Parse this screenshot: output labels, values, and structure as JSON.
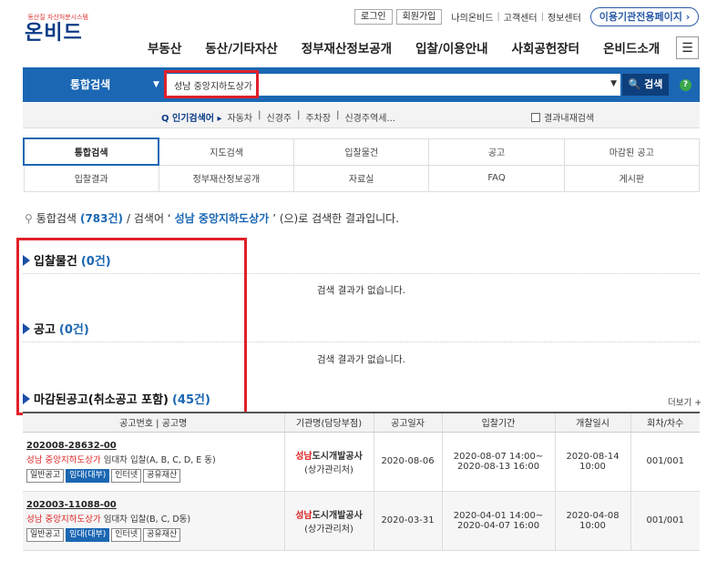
{
  "util": {
    "login": "로그인",
    "signup": "회원가입",
    "my": "나의온비드",
    "sep1": "|",
    "cs": "고객센터",
    "sep2": "|",
    "info": "정보센터",
    "org_page": "이용기관전용페이지 ›"
  },
  "logo": {
    "tagline": "동산질 자산처분시스템",
    "text": "온비드"
  },
  "nav": [
    "부동산",
    "동산/기타자산",
    "정부재산정보공개",
    "입찰/이용안내",
    "사회공헌장터",
    "온비드소개"
  ],
  "menu_icon": "☰",
  "search": {
    "scope": "통합검색",
    "value": "성남 중앙지하도상가",
    "button": "검색",
    "help": "?"
  },
  "popular": {
    "label": "인기검색어",
    "items": [
      "자동차",
      "|",
      "신경주",
      "|",
      "주차장",
      "|",
      "신경주역세..."
    ],
    "checkbox_label": "결과내재검색"
  },
  "categories": [
    [
      "통합검색",
      "지도검색",
      "입찰물건",
      "공고",
      "마감된 공고"
    ],
    [
      "입찰결과",
      "정부재산정보공개",
      "자료실",
      "FAQ",
      "게시판"
    ]
  ],
  "summary": {
    "prefix": "통합검색",
    "count": "(783건)",
    "mid": "/ 검색어 ‘",
    "keyword": "성남 중앙지하도상가",
    "suffix": "’ (으)로 검색한 결과입니다."
  },
  "sections": [
    {
      "title": "입찰물건",
      "count": "(0건)",
      "empty": "검색 결과가 없습니다."
    },
    {
      "title": "공고",
      "count": "(0건)",
      "empty": "검색 결과가 없습니다."
    },
    {
      "title": "마감된공고(취소공고 포함)",
      "count": "(45건)"
    }
  ],
  "more": "더보기 +",
  "table": {
    "headers": [
      "공고번호 | 공고명",
      "기관명(담당부점)",
      "공고일자",
      "입찰기간",
      "개찰일시",
      "회차/차수"
    ],
    "rows": [
      {
        "id": "202008-28632-00",
        "name_hl": "성남 중앙지하도상가",
        "name_rest": " 임대차 입찰(A, B, C, D, E 동)",
        "tags": [
          "일반공고",
          "임대(대부)",
          "인터넷",
          "공유재산"
        ],
        "org_hl": "성남",
        "org_rest": "도시개발공사",
        "org_sub": "(상가관리처)",
        "date": "2020-08-06",
        "period1": "2020-08-07 14:00~",
        "period2": "2020-08-13 16:00",
        "open": "2020-08-14 10:00",
        "round": "001/001"
      },
      {
        "id": "202003-11088-00",
        "name_hl": "성남 중앙지하도상가",
        "name_rest": " 임대차 입찰(B, C, D동)",
        "tags": [
          "일반공고",
          "임대(대부)",
          "인터넷",
          "공유재산"
        ],
        "org_hl": "성남",
        "org_rest": "도시개발공사",
        "org_sub": "(상가관리처)",
        "date": "2020-03-31",
        "period1": "2020-04-01 14:00~",
        "period2": "2020-04-07 16:00",
        "open": "2020-04-08 10:00",
        "round": "001/001"
      }
    ]
  },
  "colors": {
    "primary": "#1b67b3",
    "highlight": "#e0202a"
  }
}
